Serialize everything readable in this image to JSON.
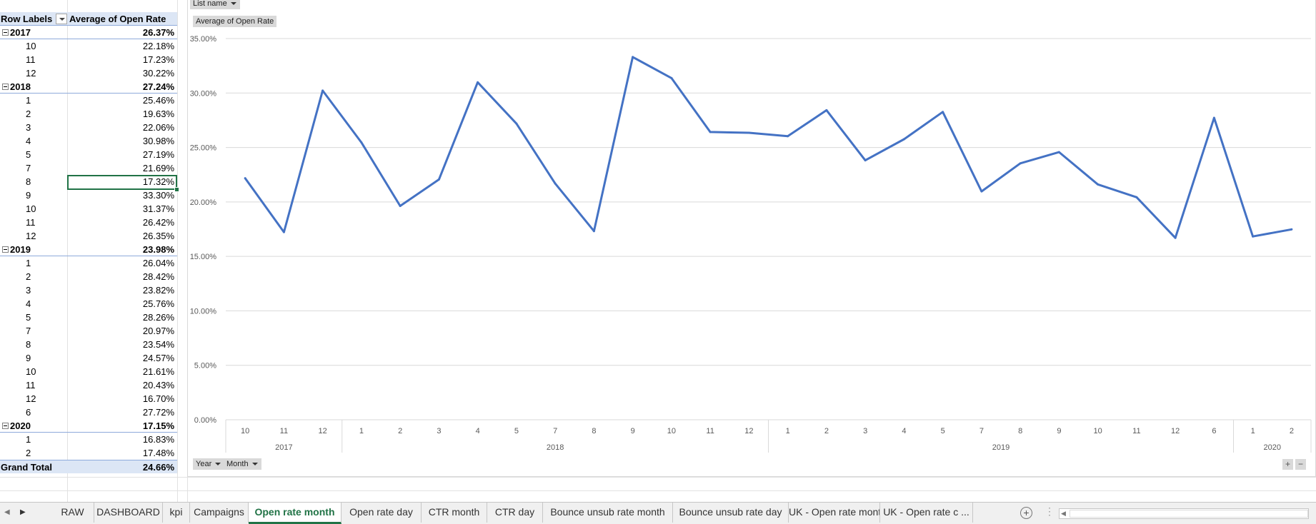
{
  "pivot": {
    "header_label": "Row Labels",
    "header_value": "Average of Open Rate",
    "rows": [
      {
        "kind": "year",
        "label": "2017",
        "value": "26.37%"
      },
      {
        "kind": "month",
        "label": "10",
        "value": "22.18%"
      },
      {
        "kind": "month",
        "label": "11",
        "value": "17.23%"
      },
      {
        "kind": "month",
        "label": "12",
        "value": "30.22%"
      },
      {
        "kind": "year",
        "label": "2018",
        "value": "27.24%"
      },
      {
        "kind": "month",
        "label": "1",
        "value": "25.46%"
      },
      {
        "kind": "month",
        "label": "2",
        "value": "19.63%"
      },
      {
        "kind": "month",
        "label": "3",
        "value": "22.06%"
      },
      {
        "kind": "month",
        "label": "4",
        "value": "30.98%"
      },
      {
        "kind": "month",
        "label": "5",
        "value": "27.19%"
      },
      {
        "kind": "month",
        "label": "7",
        "value": "21.69%"
      },
      {
        "kind": "month",
        "label": "8",
        "value": "17.32%"
      },
      {
        "kind": "month",
        "label": "9",
        "value": "33.30%"
      },
      {
        "kind": "month",
        "label": "10",
        "value": "31.37%"
      },
      {
        "kind": "month",
        "label": "11",
        "value": "26.42%"
      },
      {
        "kind": "month",
        "label": "12",
        "value": "26.35%"
      },
      {
        "kind": "year",
        "label": "2019",
        "value": "23.98%"
      },
      {
        "kind": "month",
        "label": "1",
        "value": "26.04%"
      },
      {
        "kind": "month",
        "label": "2",
        "value": "28.42%"
      },
      {
        "kind": "month",
        "label": "3",
        "value": "23.82%"
      },
      {
        "kind": "month",
        "label": "4",
        "value": "25.76%"
      },
      {
        "kind": "month",
        "label": "5",
        "value": "28.26%"
      },
      {
        "kind": "month",
        "label": "7",
        "value": "20.97%"
      },
      {
        "kind": "month",
        "label": "8",
        "value": "23.54%"
      },
      {
        "kind": "month",
        "label": "9",
        "value": "24.57%"
      },
      {
        "kind": "month",
        "label": "10",
        "value": "21.61%"
      },
      {
        "kind": "month",
        "label": "11",
        "value": "20.43%"
      },
      {
        "kind": "month",
        "label": "12",
        "value": "16.70%"
      },
      {
        "kind": "month",
        "label": "6",
        "value": "27.72%"
      },
      {
        "kind": "year",
        "label": "2020",
        "value": "17.15%"
      },
      {
        "kind": "month",
        "label": "1",
        "value": "16.83%"
      },
      {
        "kind": "month",
        "label": "2",
        "value": "17.48%"
      }
    ],
    "grand_label": "Grand Total",
    "grand_value": "24.66%"
  },
  "chart_buttons": {
    "list_name": "List name",
    "value_field": "Average of Open Rate",
    "year": "Year",
    "month": "Month",
    "zoom_in": "+",
    "zoom_out": "−"
  },
  "chart_data": {
    "type": "line",
    "title": "",
    "xlabel": "",
    "ylabel": "",
    "ylim": [
      0,
      35
    ],
    "y_ticks": [
      "0.00%",
      "5.00%",
      "10.00%",
      "15.00%",
      "20.00%",
      "25.00%",
      "30.00%",
      "35.00%"
    ],
    "grid": true,
    "color": "#4472c4",
    "groups": [
      {
        "label": "2017",
        "months": [
          "10",
          "11",
          "12"
        ]
      },
      {
        "label": "2018",
        "months": [
          "1",
          "2",
          "3",
          "4",
          "5",
          "7",
          "8",
          "9",
          "10",
          "11",
          "12"
        ]
      },
      {
        "label": "2019",
        "months": [
          "1",
          "2",
          "3",
          "4",
          "5",
          "7",
          "8",
          "9",
          "10",
          "11",
          "12",
          "6"
        ]
      },
      {
        "label": "2020",
        "months": [
          "1",
          "2"
        ]
      }
    ],
    "values": [
      22.18,
      17.23,
      30.22,
      25.46,
      19.63,
      22.06,
      30.98,
      27.19,
      21.69,
      17.32,
      33.3,
      31.37,
      26.42,
      26.35,
      26.04,
      28.42,
      23.82,
      25.76,
      28.26,
      20.97,
      23.54,
      24.57,
      21.61,
      20.43,
      16.7,
      27.72,
      16.83,
      17.48
    ]
  },
  "tabs": [
    {
      "label": "RAW",
      "active": false
    },
    {
      "label": "DASHBOARD",
      "active": false
    },
    {
      "label": "kpi",
      "active": false
    },
    {
      "label": "Campaigns",
      "active": false
    },
    {
      "label": "Open rate month",
      "active": true
    },
    {
      "label": "Open rate day",
      "active": false
    },
    {
      "label": "CTR month",
      "active": false
    },
    {
      "label": "CTR day",
      "active": false
    },
    {
      "label": "Bounce unsub rate month",
      "active": false
    },
    {
      "label": "Bounce unsub rate day",
      "active": false
    },
    {
      "label": "UK - Open rate month",
      "active": false
    },
    {
      "label": "UK - Open rate c ...",
      "active": false
    }
  ],
  "tabbar": {
    "add": "+",
    "dots": "⋮",
    "nav_prev": "◀",
    "nav_next": "▶",
    "scroll_left": "◀"
  }
}
